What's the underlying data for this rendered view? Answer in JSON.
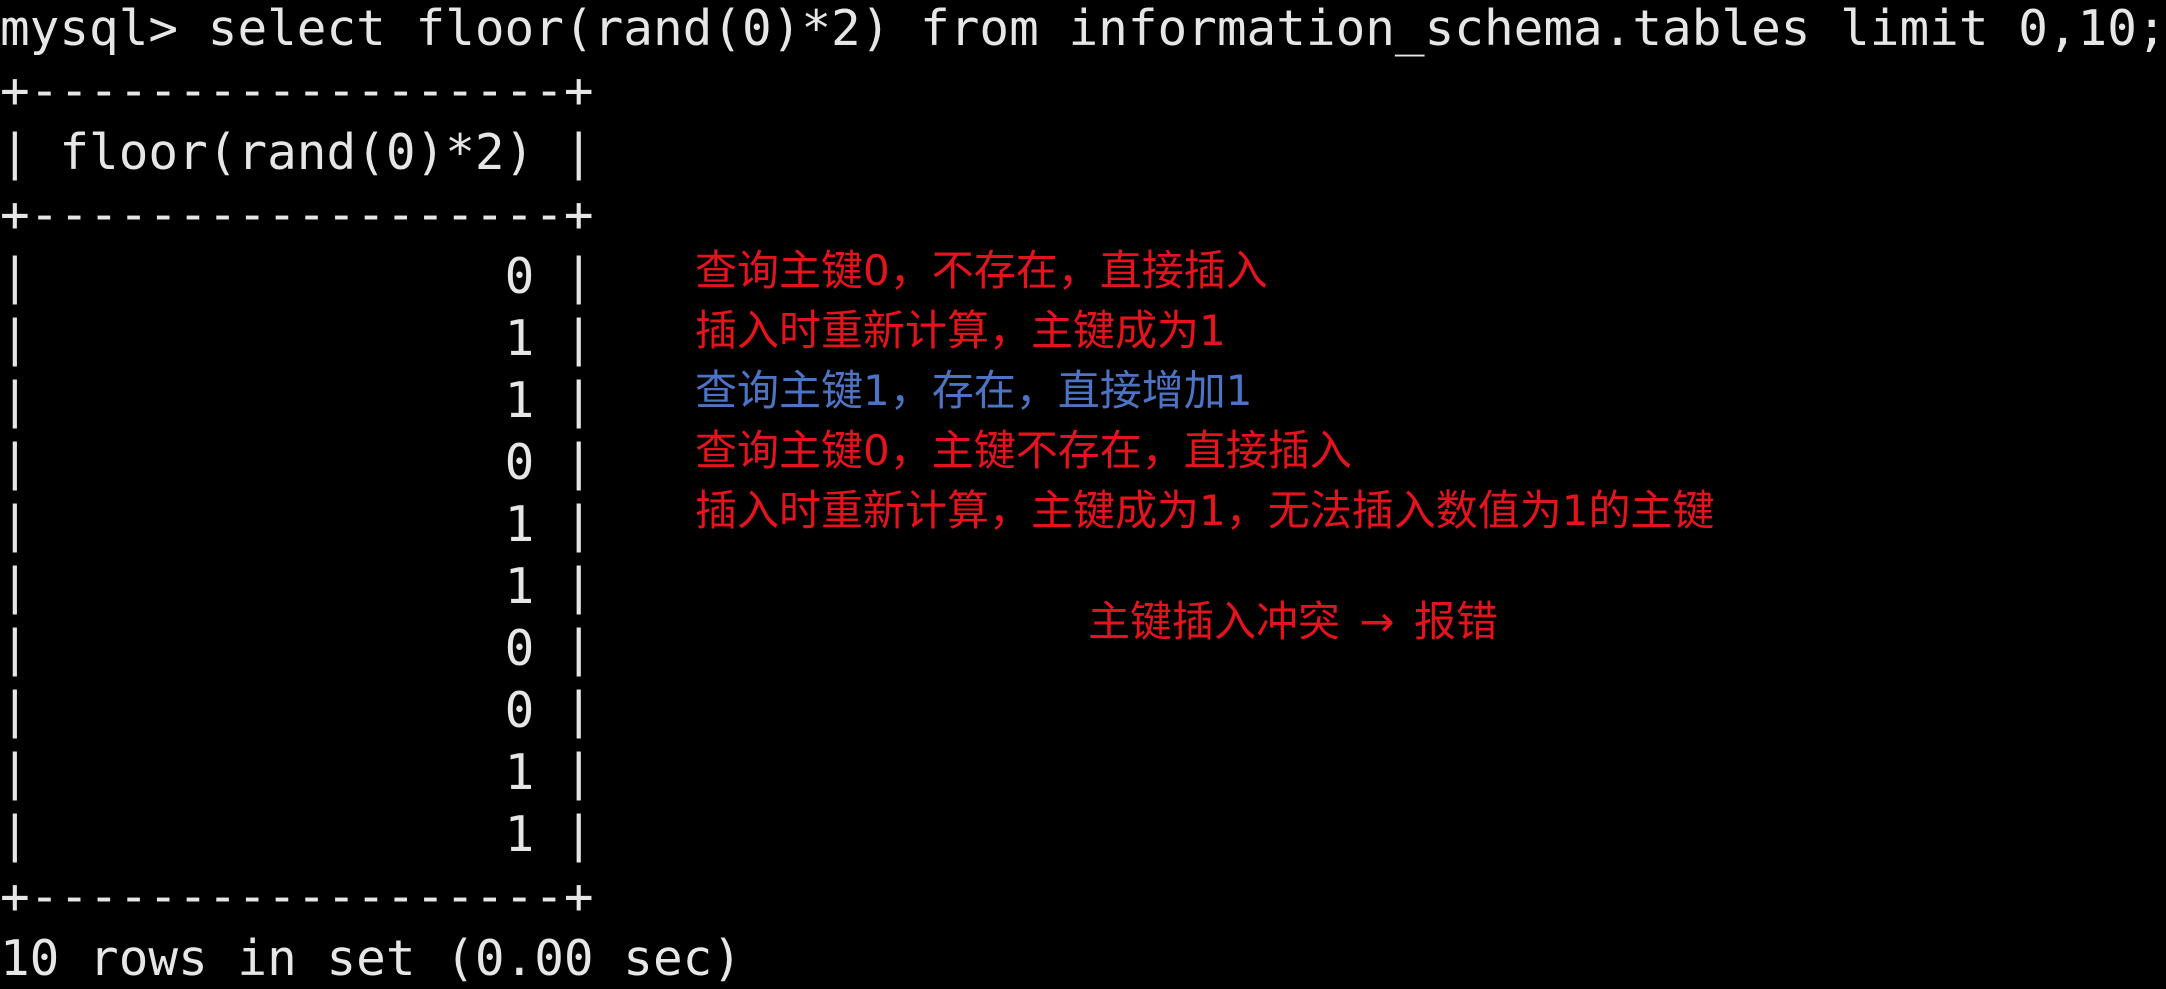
{
  "terminal": {
    "prompt": "mysql>",
    "command": "select floor(rand(0)*2) from information_schema.tables limit 0,10;",
    "table": {
      "border": "+------------------+",
      "column_header": "floor(rand(0)*2)",
      "rows": [
        "0",
        "1",
        "1",
        "0",
        "1",
        "1",
        "0",
        "0",
        "1",
        "1"
      ]
    },
    "result_summary": "10 rows in set (0.00 sec)"
  },
  "annotations": {
    "colors": {
      "red": "#e4131c",
      "blue": "#4d74c4",
      "terminal_text": "#e6e6e6",
      "background": "#000000"
    },
    "notes": [
      {
        "text": "查询主键0，不存在，直接插入",
        "color": "red"
      },
      {
        "text": "插入时重新计算，主键成为1",
        "color": "red"
      },
      {
        "text": "查询主键1，存在，直接增加1",
        "color": "blue"
      },
      {
        "text": "查询主键0，主键不存在，直接插入",
        "color": "red"
      },
      {
        "text": "插入时重新计算，主键成为1，无法插入数值为1的主键",
        "color": "red"
      }
    ],
    "conclusion": {
      "left": "主键插入冲突",
      "arrow": "→",
      "right": "报错",
      "color": "red"
    }
  }
}
